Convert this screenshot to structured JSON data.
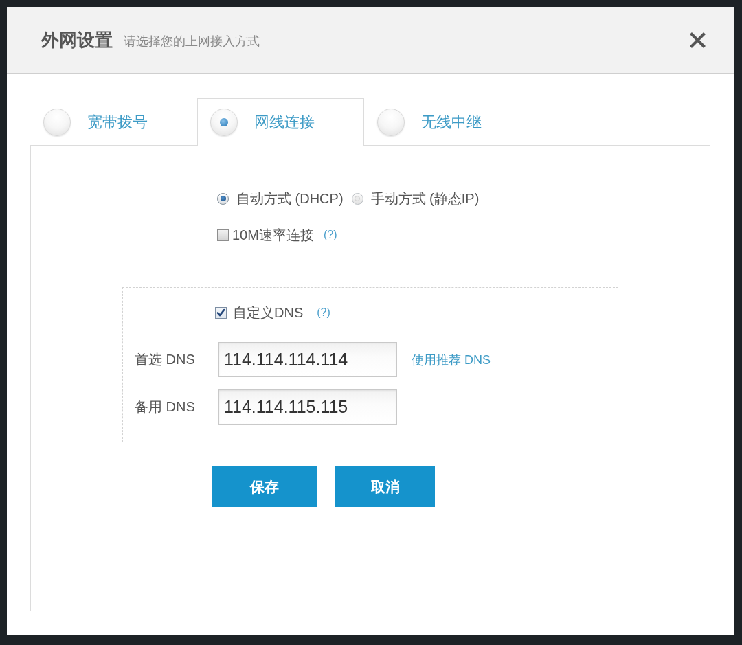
{
  "dialog": {
    "title": "外网设置",
    "subtitle": "请选择您的上网接入方式"
  },
  "tabs": [
    {
      "label": "宽带拨号",
      "selected": false
    },
    {
      "label": "网线连接",
      "selected": true
    },
    {
      "label": "无线中继",
      "selected": false
    }
  ],
  "connection_modes": [
    {
      "label": "自动方式 (DHCP)",
      "selected": true
    },
    {
      "label": "手动方式 (静态IP)",
      "selected": false
    }
  ],
  "speed_limit": {
    "label": "10M速率连接",
    "checked": false,
    "help": "(?)"
  },
  "dns": {
    "custom": {
      "label": "自定义DNS",
      "checked": true,
      "help": "(?)"
    },
    "fields": [
      {
        "label": "首选 DNS",
        "value": "114.114.114.114",
        "link": "使用推荐 DNS"
      },
      {
        "label": "备用 DNS",
        "value": "114.114.115.115"
      }
    ]
  },
  "buttons": [
    "保存",
    "取消"
  ]
}
